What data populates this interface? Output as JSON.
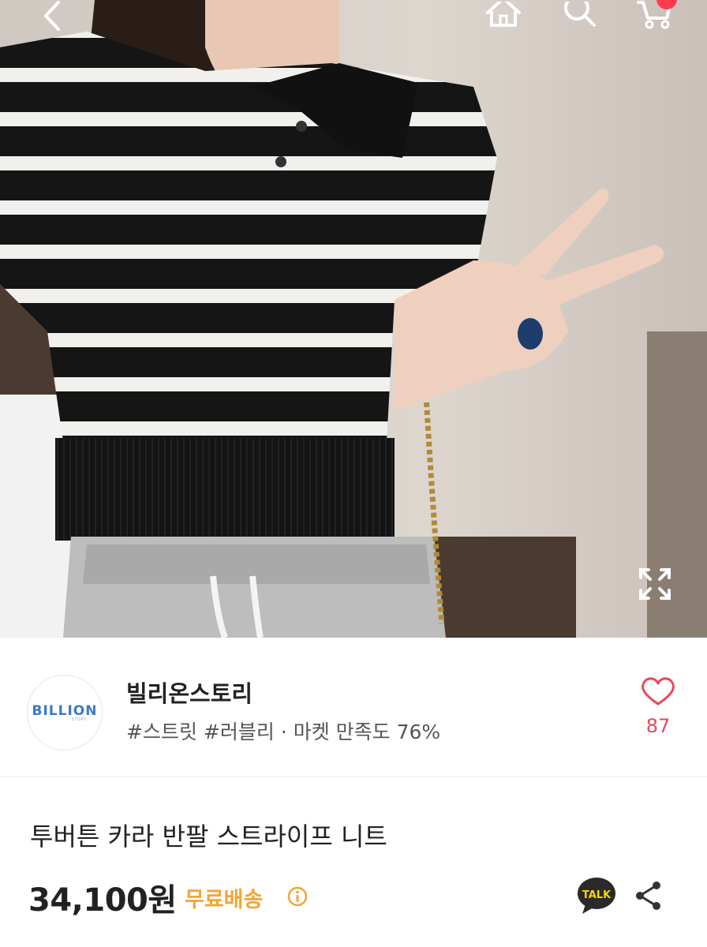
{
  "top_bar": {
    "icons": [
      "back-icon",
      "home-icon",
      "search-icon",
      "cart-icon",
      "expand-icon"
    ],
    "cart_badge_color": "#ff3b4f"
  },
  "shop": {
    "logo_text": "BILLION",
    "logo_subtext": "STORY",
    "name": "빌리온스토리",
    "tags": "#스트릿 #러블리",
    "separator": "·",
    "satisfaction": "마켓 만족도 76%",
    "likes": "87"
  },
  "product": {
    "title": "투버튼 카라 반팔 스트라이프 니트",
    "price": "34,100원",
    "shipping": "무료배송",
    "talk_label": "TALK"
  },
  "colors": {
    "accent_like": "#e8485a",
    "shipping": "#f2a534",
    "talk": "#2a2a2a"
  }
}
